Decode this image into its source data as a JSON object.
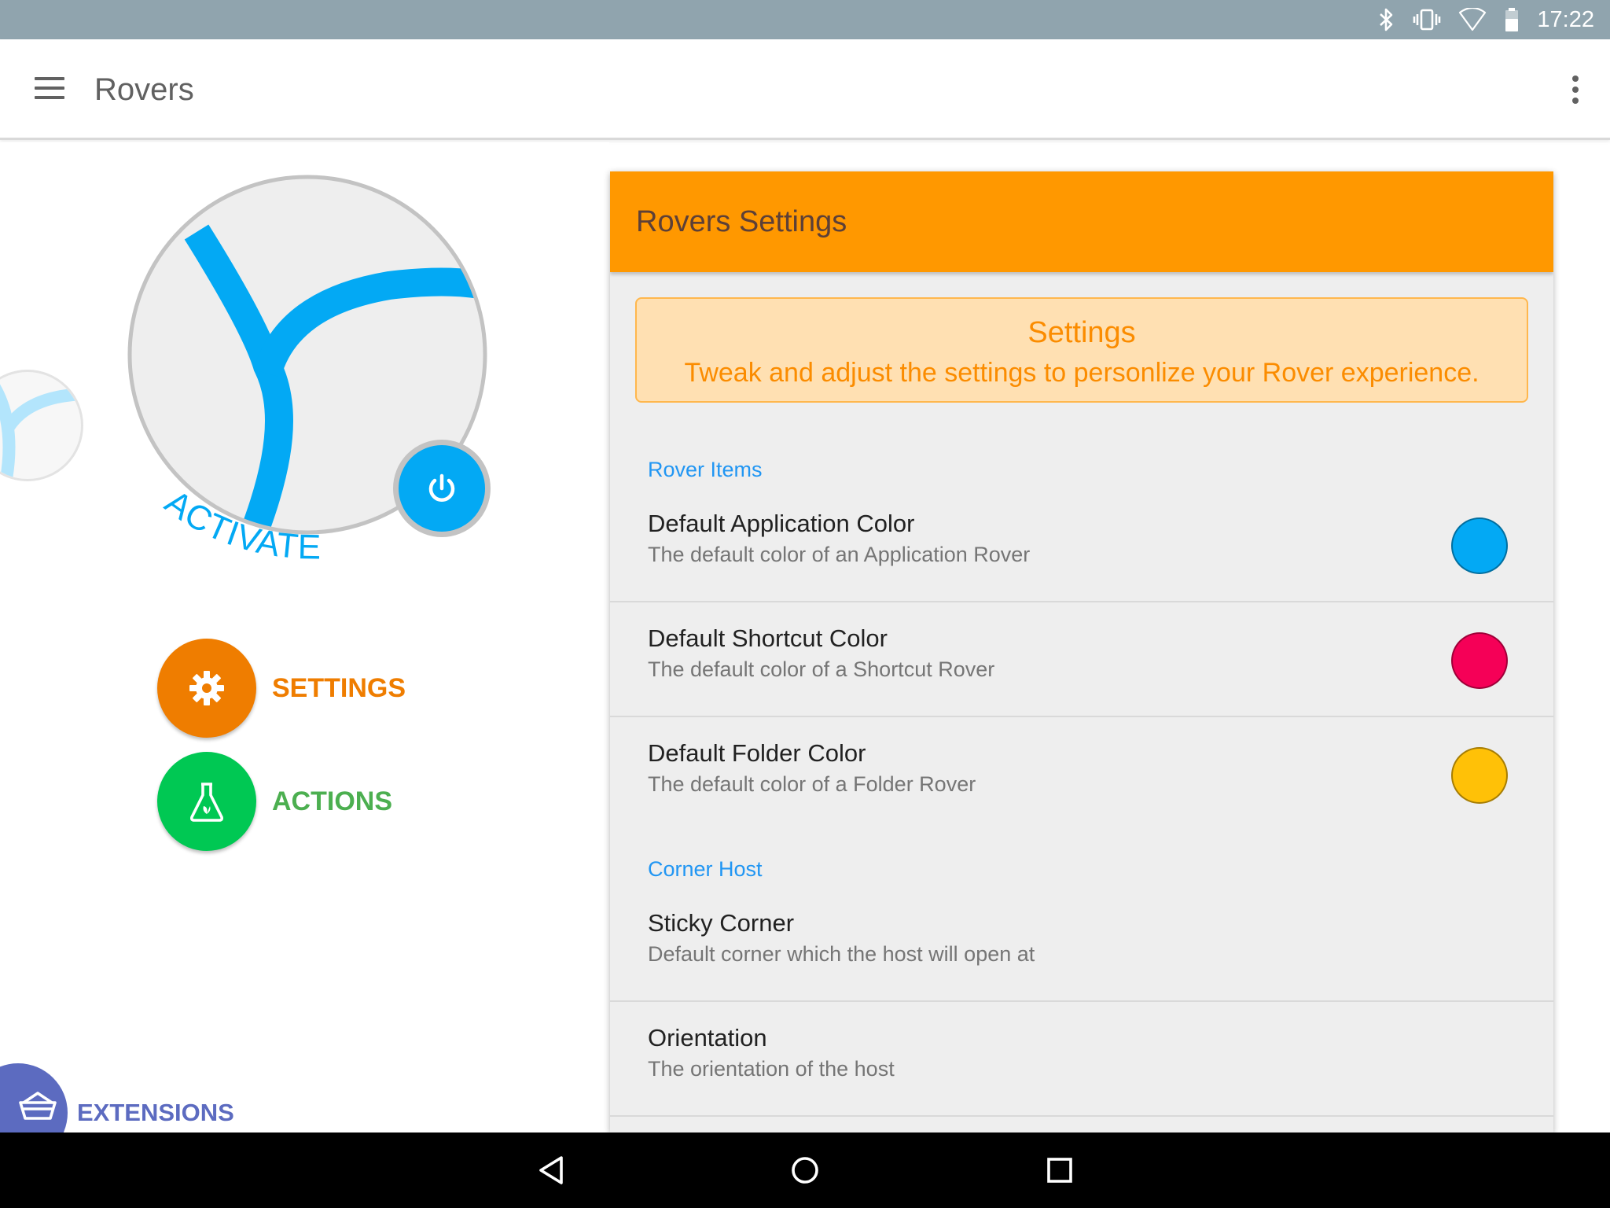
{
  "status_bar": {
    "time": "17:22",
    "icons": [
      "bluetooth-icon",
      "vibrate-icon",
      "wifi-icon",
      "battery-icon"
    ]
  },
  "app_bar": {
    "title": "Rovers",
    "icons": [
      "menu-icon",
      "overflow-menu-icon"
    ]
  },
  "rover_preview": {
    "status_text": "ACTIVATED",
    "accent_color": "#03a9f4",
    "icons": [
      "rover-logo-icon",
      "power-icon"
    ]
  },
  "nav_menu": {
    "settings": {
      "label": "SETTINGS",
      "color": "#ef6c00",
      "icon": "gear-icon"
    },
    "actions": {
      "label": "ACTIONS",
      "color": "#4caf50",
      "icon": "flask-icon"
    },
    "extensions": {
      "label": "EXTENSIONS",
      "color": "#5c6bc0",
      "icon": "basket-icon"
    }
  },
  "settings_panel": {
    "title": "Rovers Settings",
    "header_color": "#ff9800",
    "info_card": {
      "title": "Settings",
      "text": "Tweak and adjust the settings to personlize your Rover experience."
    },
    "sections": [
      {
        "header": "Rover Items",
        "items": [
          {
            "title": "Default Application Color",
            "subtitle": "The default color of an Application Rover",
            "color": "#03a9f4"
          },
          {
            "title": "Default Shortcut Color",
            "subtitle": "The default color of a Shortcut Rover",
            "color": "#f50057"
          },
          {
            "title": "Default Folder Color",
            "subtitle": "The default color of a Folder Rover",
            "color": "#ffc107"
          }
        ]
      },
      {
        "header": "Corner Host",
        "items": [
          {
            "title": "Sticky Corner",
            "subtitle": "Default corner which the host will open at"
          },
          {
            "title": "Orientation",
            "subtitle": "The orientation of the host"
          }
        ]
      }
    ]
  },
  "system_nav": {
    "icons": [
      "back-icon",
      "home-icon",
      "recents-icon"
    ]
  }
}
